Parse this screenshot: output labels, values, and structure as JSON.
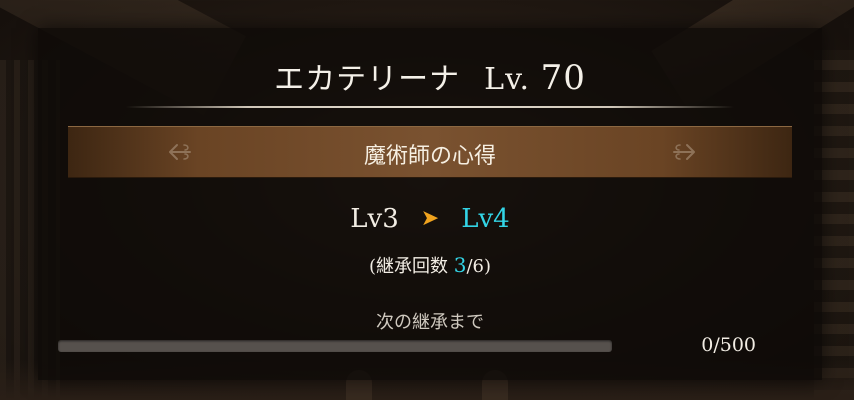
{
  "dialog": {
    "character_name": "エカテリーナ",
    "level_prefix": "Lv.",
    "level_value": "70",
    "skill_name": "魔術師の心得",
    "level_from": "Lv3",
    "level_to": "Lv4",
    "inherit_prefix": "(継承回数",
    "inherit_current": "3",
    "inherit_suffix": "/6)",
    "next_label": "次の継承まで",
    "progress_text": "0/500",
    "progress_fraction": 0
  },
  "icons": {
    "level_arrow": "chevron-right-icon",
    "skill_prev": "ornate-left-arrow-icon",
    "skill_next": "ornate-right-arrow-icon"
  },
  "colors": {
    "accent_cyan": "#33d4e6",
    "arrow_orange": "#f0a31e",
    "skill_bar_brown": "#7a5230"
  }
}
